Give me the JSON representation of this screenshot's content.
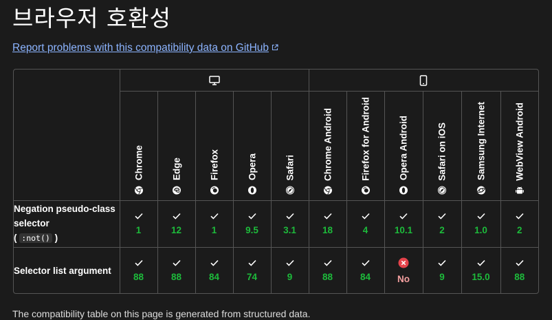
{
  "page": {
    "title": "브라우저 호환성",
    "report_link": "Report problems with this compatibility data on GitHub"
  },
  "colors": {
    "background": "#1b1b1b",
    "link": "#8cb4ff",
    "supported": "#1dbb3b",
    "unsupported": "#e5434b",
    "border": "#555555"
  },
  "platforms": [
    {
      "name": "desktop",
      "icon": "desktop-monitor-icon"
    },
    {
      "name": "mobile",
      "icon": "mobile-phone-icon"
    }
  ],
  "browsers": [
    {
      "name": "Chrome",
      "icon": "chrome-icon"
    },
    {
      "name": "Edge",
      "icon": "edge-icon"
    },
    {
      "name": "Firefox",
      "icon": "firefox-icon"
    },
    {
      "name": "Opera",
      "icon": "opera-icon"
    },
    {
      "name": "Safari",
      "icon": "safari-icon"
    },
    {
      "name": "Chrome Android",
      "icon": "chrome-icon"
    },
    {
      "name": "Firefox for Android",
      "icon": "firefox-icon"
    },
    {
      "name": "Opera Android",
      "icon": "opera-icon"
    },
    {
      "name": "Safari on iOS",
      "icon": "safari-icon"
    },
    {
      "name": "Samsung Internet",
      "icon": "samsung-internet-icon"
    },
    {
      "name": "WebView Android",
      "icon": "android-icon"
    }
  ],
  "features": [
    {
      "name": "Negation pseudo-class selector",
      "code": ":not()",
      "support": [
        {
          "supported": true,
          "version": "1"
        },
        {
          "supported": true,
          "version": "12"
        },
        {
          "supported": true,
          "version": "1"
        },
        {
          "supported": true,
          "version": "9.5"
        },
        {
          "supported": true,
          "version": "3.1"
        },
        {
          "supported": true,
          "version": "18"
        },
        {
          "supported": true,
          "version": "4"
        },
        {
          "supported": true,
          "version": "10.1"
        },
        {
          "supported": true,
          "version": "2"
        },
        {
          "supported": true,
          "version": "1.0"
        },
        {
          "supported": true,
          "version": "2"
        }
      ]
    },
    {
      "name": "Selector list argument",
      "code": "",
      "support": [
        {
          "supported": true,
          "version": "88"
        },
        {
          "supported": true,
          "version": "88"
        },
        {
          "supported": true,
          "version": "84"
        },
        {
          "supported": true,
          "version": "74"
        },
        {
          "supported": true,
          "version": "9"
        },
        {
          "supported": true,
          "version": "88"
        },
        {
          "supported": true,
          "version": "84"
        },
        {
          "supported": false,
          "version": "No"
        },
        {
          "supported": true,
          "version": "9"
        },
        {
          "supported": true,
          "version": "15.0"
        },
        {
          "supported": true,
          "version": "88"
        }
      ]
    }
  ],
  "footer_partial": "The compatibility table on this page is generated from structured data."
}
